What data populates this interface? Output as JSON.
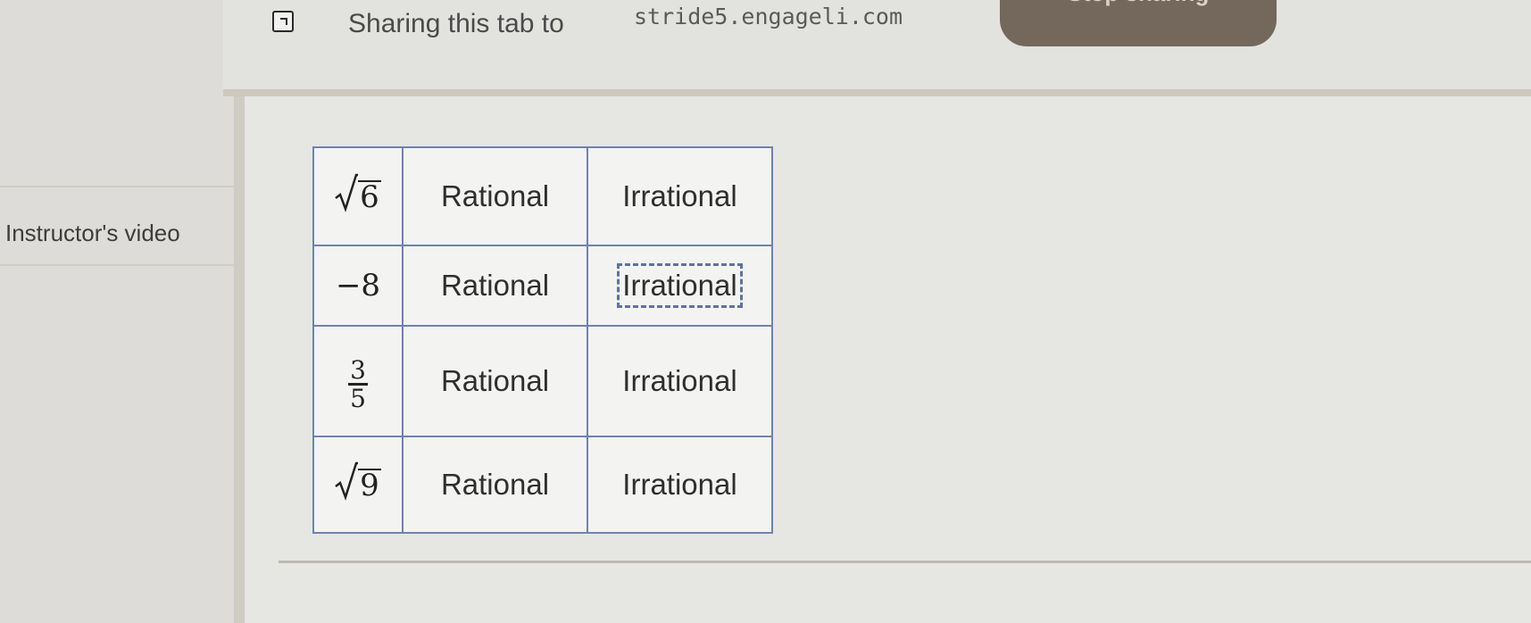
{
  "sharing_bar": {
    "message": "Sharing this tab to",
    "url": "stride5.engageli.com",
    "stop_button": "Stop sharing"
  },
  "sidebar": {
    "label": "Instructor's video"
  },
  "table": {
    "rows": [
      {
        "expression": {
          "type": "sqrt",
          "value": "6"
        },
        "options": [
          "Rational",
          "Irrational"
        ]
      },
      {
        "expression": {
          "type": "number",
          "value": "−8"
        },
        "options": [
          "Rational",
          "Irrational"
        ],
        "focused_option": 1
      },
      {
        "expression": {
          "type": "fraction",
          "numerator": "3",
          "denominator": "5"
        },
        "options": [
          "Rational",
          "Irrational"
        ]
      },
      {
        "expression": {
          "type": "sqrt",
          "value": "9"
        },
        "options": [
          "Rational",
          "Irrational"
        ]
      }
    ]
  },
  "colors": {
    "table_border": "#6f82b0",
    "stop_button_bg": "#74685c",
    "focus_outline": "#5f739f"
  }
}
